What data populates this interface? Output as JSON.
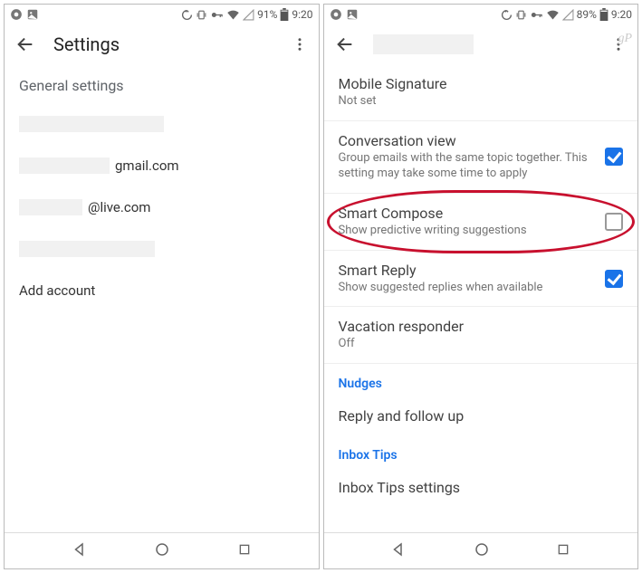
{
  "left": {
    "status": {
      "battery": "91%",
      "time": "9:20"
    },
    "appbar": {
      "title": "Settings"
    },
    "section_header": "General settings",
    "accounts": {
      "a2_suffix": "gmail.com",
      "a3_suffix": "@live.com",
      "add": "Add account"
    }
  },
  "right": {
    "status": {
      "battery": "89%",
      "time": "9:20"
    },
    "watermark": "gP",
    "items": {
      "mobile_signature": {
        "title": "Mobile Signature",
        "sub": "Not set"
      },
      "conversation_view": {
        "title": "Conversation view",
        "sub": "Group emails with the same topic together. This setting may take some time to apply"
      },
      "smart_compose": {
        "title": "Smart Compose",
        "sub": "Show predictive writing suggestions"
      },
      "smart_reply": {
        "title": "Smart Reply",
        "sub": "Show suggested replies when available"
      },
      "vacation": {
        "title": "Vacation responder",
        "sub": "Off"
      },
      "nudges_header": "Nudges",
      "reply_follow": "Reply and follow up",
      "inbox_tips_header": "Inbox Tips",
      "inbox_tips_settings": "Inbox Tips settings"
    }
  }
}
